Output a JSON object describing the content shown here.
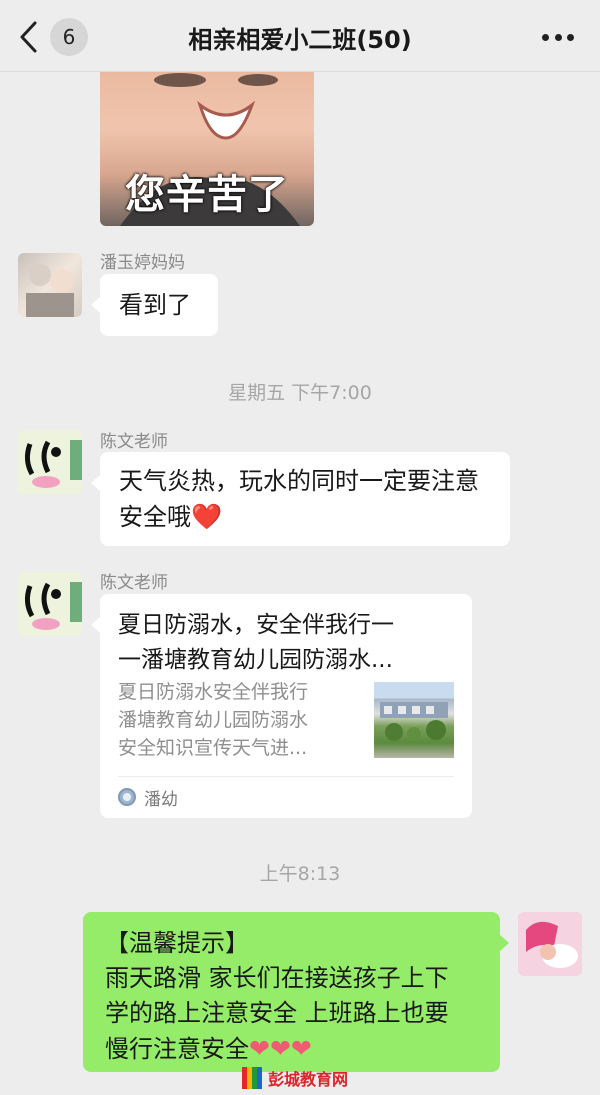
{
  "nav": {
    "unread_count": "6",
    "title": "相亲相爱小二班(50)"
  },
  "messages": {
    "sticker": {
      "caption": "您辛苦了"
    },
    "mom": {
      "sender": "潘玉婷妈妈",
      "text": "看到了"
    },
    "time1": "星期五 下午7:00",
    "teacher1": {
      "sender": "陈文老师",
      "text": "天气炎热，玩水的同时一定要注意安全哦",
      "emoji": "❤️"
    },
    "teacher2": {
      "sender": "陈文老师",
      "card_title_line1": "夏日防溺水，安全伴我行一",
      "card_title_line2": "一潘塘教育幼儿园防溺水...",
      "card_desc_line1": "夏日防溺水安全伴我行",
      "card_desc_line2": "潘塘教育幼儿园防溺水",
      "card_desc_line3": "安全知识宣传天气进...",
      "card_source": "潘幼"
    },
    "time2": "上午8:13",
    "self": {
      "line1": "【温馨提示】",
      "line2": "雨天路滑 家长们在接送孩子上下",
      "line3": "学的路上注意安全 上班路上也要",
      "line4": "慢行注意安全",
      "hearts": "❤❤❤"
    }
  },
  "watermark": {
    "text": "彭城教育网"
  },
  "colors": {
    "background": "#ededed",
    "self_bubble": "#95ec69",
    "other_bubble": "#ffffff",
    "heart": "#e8333c",
    "watermark": "#d8262b"
  },
  "icons": [
    "back-chevron-icon",
    "more-dots-icon",
    "source-logo-icon",
    "watermark-logo-icon"
  ]
}
